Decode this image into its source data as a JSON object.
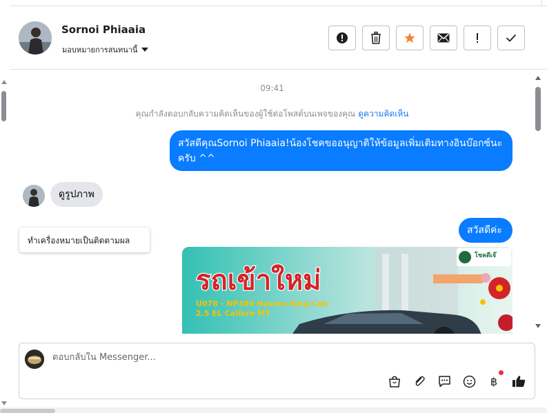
{
  "header": {
    "contact_name": "Sornoi Phiaaia",
    "assign_label": "มอบหมายการสนทนานี้",
    "actions": [
      {
        "icon": "alert-circle-icon",
        "label": "spam"
      },
      {
        "icon": "trash-icon",
        "label": "delete"
      },
      {
        "icon": "star-icon",
        "label": "follow-up"
      },
      {
        "icon": "envelope-icon",
        "label": "mark-unread"
      },
      {
        "icon": "exclamation-icon",
        "label": "important"
      },
      {
        "icon": "check-icon",
        "label": "done"
      }
    ]
  },
  "chat": {
    "timestamp": "09:41",
    "notice_text": "คุณกำลังตอบกลับความคิดเห็นของผู้ใช้ต่อโพสต์บนเพจของคุณ",
    "notice_link": "ดูความคิดเห็น",
    "messages": [
      {
        "from": "page",
        "text": "สวัสดีคุณSornoi Phiaaia!น้องโชคขออนุญาติให้ข้อมูลเพิ่มเติมทางอินบ๊อกซ์นะครับ ^^"
      },
      {
        "from": "user",
        "text": "ดูรูปภาพ"
      },
      {
        "from": "page",
        "text": "สวัสดีค่ะ"
      }
    ],
    "tooltip": "ทำเครื่องหมายเป็นติดตามผล",
    "ad": {
      "headline": "รถเข้าใหม่",
      "line1": "U078 - NP300 Navara King Cab",
      "line2": "2.5 EL Calibre MT",
      "brand_text": "โชคดีเจ๊"
    }
  },
  "composer": {
    "placeholder": "ตอบกลับใน Messenger...",
    "tools": [
      "shopping-bag-icon",
      "paperclip-icon",
      "saved-reply-icon",
      "emoji-icon",
      "baht-icon",
      "thumbs-up-icon"
    ],
    "baht_symbol": "฿"
  },
  "colors": {
    "accent": "#0a7cff",
    "star": "#f5862e",
    "link": "#1877f2",
    "notification": "#f02849"
  }
}
